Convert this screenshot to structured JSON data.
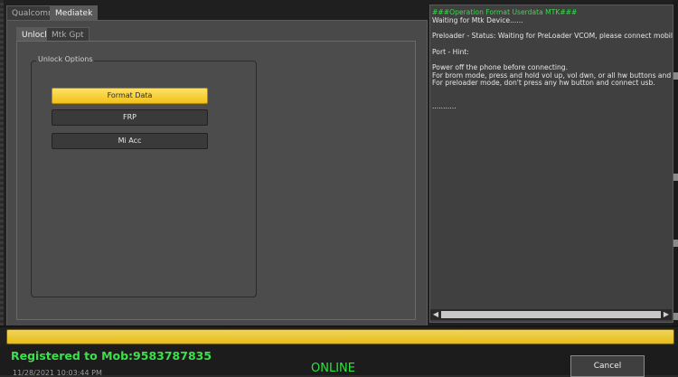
{
  "top_tabs": [
    {
      "label": "Qualcomm",
      "active": false
    },
    {
      "label": "Mediatek",
      "active": true
    }
  ],
  "sub_tabs": [
    {
      "label": "Unlock",
      "active": true
    },
    {
      "label": "Mtk Gpt",
      "active": false
    }
  ],
  "unlock_options": {
    "title": "Unlock Options",
    "buttons": [
      {
        "label": "Format Data",
        "highlighted": true
      },
      {
        "label": "FRP",
        "highlighted": false
      },
      {
        "label": "Mi Acc",
        "highlighted": false
      }
    ]
  },
  "log": {
    "lines": [
      {
        "text": "###Operation Format Userdata MTK###",
        "color": "green"
      },
      {
        "text": "Waiting for Mtk Device......",
        "color": "white"
      },
      {
        "text": "",
        "color": "white"
      },
      {
        "text": "Preloader - Status: Waiting for PreLoader VCOM, please connect mobile",
        "color": "white"
      },
      {
        "text": "",
        "color": "white"
      },
      {
        "text": "Port - Hint:",
        "color": "white"
      },
      {
        "text": "",
        "color": "white"
      },
      {
        "text": "Power off the phone before connecting.",
        "color": "white"
      },
      {
        "text": "For brom mode, press and hold vol up, vol dwn, or all hw buttons and co",
        "color": "white"
      },
      {
        "text": "For preloader mode, don't press any hw button and connect usb.",
        "color": "white"
      },
      {
        "text": "",
        "color": "white"
      },
      {
        "text": "",
        "color": "white"
      },
      {
        "text": "...........",
        "color": "white"
      }
    ]
  },
  "status": {
    "registered": "Registered to Mob:9583787835",
    "online": "ONLINE",
    "datetime": "11/28/2021 10:03:44 PM",
    "cancel_label": "Cancel"
  },
  "colors": {
    "accent_yellow": "#f2c21a",
    "online_green": "#2fe13f",
    "log_green": "#39d94b"
  }
}
